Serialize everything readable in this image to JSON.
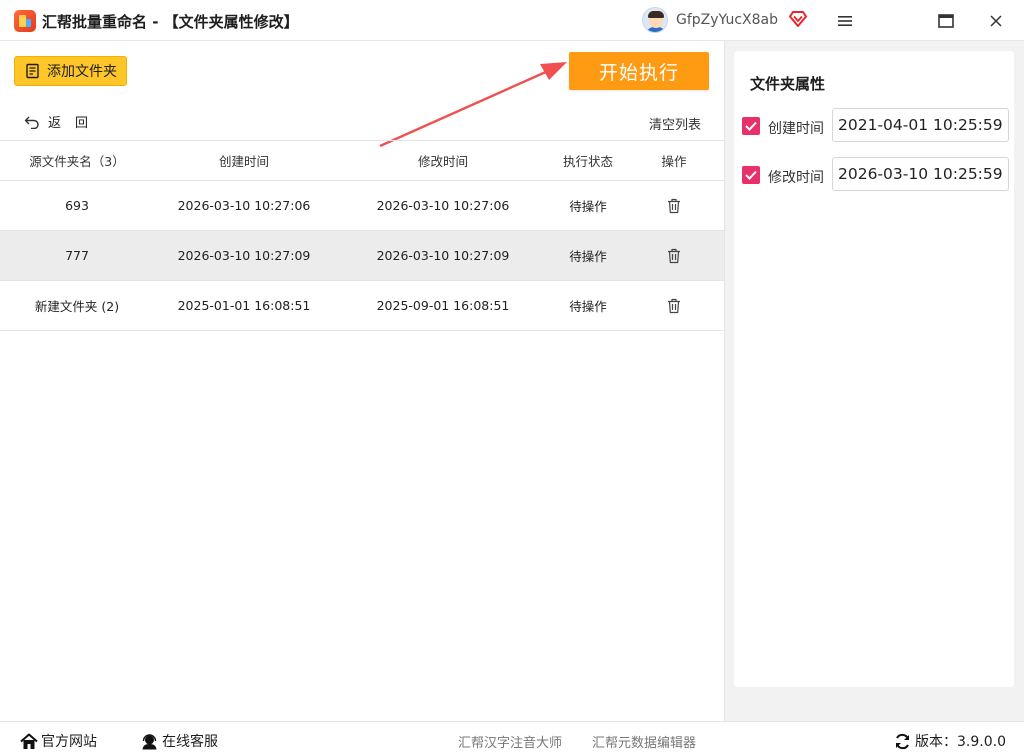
{
  "titlebar": {
    "title": "汇帮批量重命名 - 【文件夹属性修改】",
    "username": "GfpZyYucX8ab"
  },
  "toolbar": {
    "add_folder_label": "添加文件夹",
    "start_label": "开始执行",
    "back_label": "返回",
    "clear_list_label": "清空列表"
  },
  "table": {
    "headers": [
      "源文件夹名（3）",
      "创建时间",
      "修改时间",
      "执行状态",
      "操作"
    ],
    "rows": [
      {
        "name": "693",
        "created": "2026-03-10 10:27:06",
        "modified": "2026-03-10 10:27:06",
        "status": "待操作"
      },
      {
        "name": "777",
        "created": "2026-03-10 10:27:09",
        "modified": "2026-03-10 10:27:09",
        "status": "待操作"
      },
      {
        "name": "新建文件夹 (2)",
        "created": "2025-01-01 16:08:51",
        "modified": "2025-09-01 16:08:51",
        "status": "待操作"
      }
    ]
  },
  "attributes": {
    "title": "文件夹属性",
    "created_label": "创建时间",
    "created_value": "2021-04-01 10:25:59",
    "created_checked": true,
    "modified_label": "修改时间",
    "modified_value": "2026-03-10 10:25:59",
    "modified_checked": true
  },
  "footer": {
    "website": "官方网站",
    "support": "在线客服",
    "link1": "汇帮汉字注音大师",
    "link2": "汇帮元数据编辑器",
    "version": "版本：3.9.0.0"
  },
  "colors": {
    "accent_orange": "#ff9a13",
    "accent_yellow": "#ffc62a",
    "checkbox_pink": "#e8306a",
    "arrow_red": "#f0504f"
  }
}
